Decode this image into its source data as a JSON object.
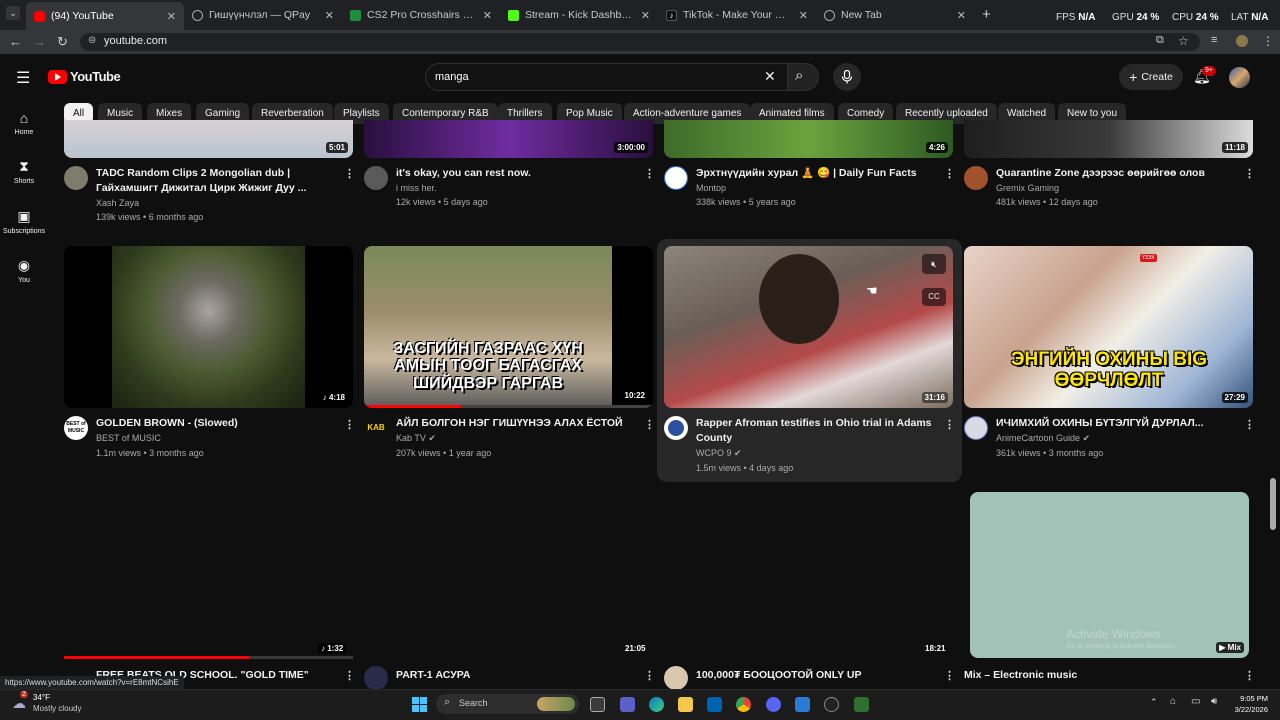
{
  "browser": {
    "tabs": [
      {
        "title": "(94) YouTube",
        "favicon_color": "#ff0000"
      },
      {
        "title": "Гишүүнчлэл — QPay",
        "favicon_color": "#888888"
      },
      {
        "title": "CS2 Pro Crosshairs List | ProCr…",
        "favicon_color": "#1e8e3e"
      },
      {
        "title": "Stream - Kick Dashboard",
        "favicon_color": "#53fc18"
      },
      {
        "title": "TikTok - Make Your Day",
        "favicon_color": "#111111"
      },
      {
        "title": "New Tab",
        "favicon_color": "#888888"
      }
    ],
    "url": "youtube.com",
    "status_url": "https://www.youtube.com/watch?v=rE8mtNCsihE"
  },
  "overlay": {
    "fps_label": "FPS",
    "fps_value": "N/A",
    "gpu_label": "GPU",
    "gpu_value": "24 %",
    "cpu_label": "CPU",
    "cpu_value": "24 %",
    "lat_label": "LAT",
    "lat_value": "N/A"
  },
  "header": {
    "logo_text": "YouTube",
    "search_value": "manga",
    "create_label": "Create",
    "notification_badge": "9+"
  },
  "chips": [
    "All",
    "Music",
    "Mixes",
    "Gaming",
    "Reverberation",
    "Playlists",
    "Contemporary R&B",
    "Thrillers",
    "Pop Music",
    "Action-adventure games",
    "Animated films",
    "Comedy",
    "Recently uploaded",
    "Watched",
    "New to you"
  ],
  "sidebar": [
    {
      "label": "Home",
      "icon": "home-icon"
    },
    {
      "label": "Shorts",
      "icon": "shorts-icon"
    },
    {
      "label": "Subscriptions",
      "icon": "subscriptions-icon"
    },
    {
      "label": "You",
      "icon": "you-icon"
    }
  ],
  "videos_row1": [
    {
      "title": "TADC Random Clips 2 Mongolian dub | Гайхамшигт Дижитал Цирк Жижиг Дуу ...",
      "channel": "Xash Zaya",
      "views": "139k views",
      "age": "6 months ago",
      "duration": "5:01"
    },
    {
      "title": "it's okay, you can rest now.",
      "channel": "i miss her.",
      "views": "12k views",
      "age": "5 days ago",
      "duration": "3:00:00"
    },
    {
      "title": "Эрхтнүүдийн хурал 🧘 😋 | Daily Fun Facts 😝",
      "channel": "Montop",
      "views": "338k views",
      "age": "5 years ago",
      "duration": "4:26"
    },
    {
      "title": "Quarantine Zone дээрээс өөрийгөө олов",
      "channel": "Gremix Gaming",
      "views": "481k views",
      "age": "12 days ago",
      "duration": "11:18"
    }
  ],
  "videos_row2": [
    {
      "title": "GOLDEN BROWN - (Slowed)",
      "channel": "BEST of MUSIC",
      "views": "1.1m views",
      "age": "3 months ago",
      "duration": "4:18",
      "avatar_text": "BEST of MUSIC"
    },
    {
      "title": "АЙЛ БОЛГОН НЭГ ГИШҮҮНЭЭ АЛАХ ЁСТОЙ",
      "channel": "Kab TV",
      "views": "207k views",
      "age": "1 year ago",
      "duration": "10:22",
      "overlay_text": "ЗАСГИЙН ГАЗРААС ХҮН АМЫН ТООГ БАГАСГАХ ШИЙДВЭР ГАРГАВ",
      "avatar_text": "KAB"
    },
    {
      "title": "Rapper Afroman testifies in Ohio trial in Adams County",
      "channel": "WCPO 9",
      "views": "1.5m views",
      "age": "4 days ago",
      "duration": "31:16",
      "cc_label": "CC"
    },
    {
      "title": "ИЧИМХИЙ ОХИНЫ БҮТЭЛГҮЙ ДУРЛАЛ...",
      "channel": "AnimeCartoon Guide",
      "views": "361k views",
      "age": "3 months ago",
      "duration": "27:29",
      "overlay_text": "ЭНГИЙН ОХИНЫ BIG ӨӨРЧЛӨЛТ",
      "badge": "ҮЗЭХ"
    }
  ],
  "videos_row3": [
    {
      "title": "FREE BEATS OLD SCHOOL. \"GOLD TIME\" PRODD",
      "duration": "1:32"
    },
    {
      "title": "PART-1 АСУРА",
      "duration": "21:05"
    },
    {
      "title": "100,000₮ БООЦООТОЙ ONLY UP",
      "duration": "18:21"
    },
    {
      "title": "Mix – Electronic music",
      "duration": "Mix"
    }
  ],
  "watermark": {
    "line1": "Activate Windows",
    "line2": "Go to Settings to activate Windows."
  },
  "taskbar": {
    "weather_temp": "34°F",
    "weather_desc": "Mostly cloudy",
    "weather_badge": "2",
    "search_label": "Search",
    "time": "9:05 PM",
    "date": "3/22/2026"
  }
}
